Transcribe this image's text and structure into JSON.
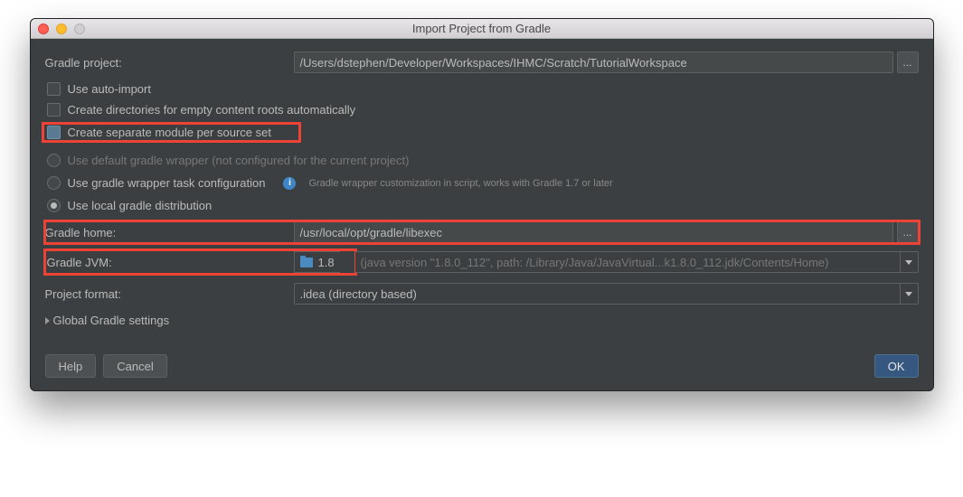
{
  "window": {
    "title": "Import Project from Gradle"
  },
  "labels": {
    "gradle_project": "Gradle project:",
    "gradle_home": "Gradle home:",
    "gradle_jvm": "Gradle JVM:",
    "project_format": "Project format:",
    "global_settings": "Global Gradle settings"
  },
  "values": {
    "gradle_project_path": "/Users/dstephen/Developer/Workspaces/IHMC/Scratch/TutorialWorkspace",
    "gradle_home_path": "/usr/local/opt/gradle/libexec",
    "project_format_value": ".idea (directory based)"
  },
  "checkboxes": {
    "auto_import": "Use auto-import",
    "create_dirs": "Create directories for empty content roots automatically",
    "separate_module": "Create separate module per source set"
  },
  "radios": {
    "default_wrapper": "Use default gradle wrapper (not configured for the current project)",
    "wrapper_task": "Use gradle wrapper task configuration",
    "wrapper_hint": "Gradle wrapper customization in script, works with Gradle 1.7 or later",
    "local_dist": "Use local gradle distribution"
  },
  "jvm": {
    "version": "1.8",
    "detail": "(java version \"1.8.0_112\", path: /Library/Java/JavaVirtual...k1.8.0_112.jdk/Contents/Home)"
  },
  "buttons": {
    "help": "Help",
    "cancel": "Cancel",
    "ok": "OK",
    "ellipsis": "..."
  }
}
